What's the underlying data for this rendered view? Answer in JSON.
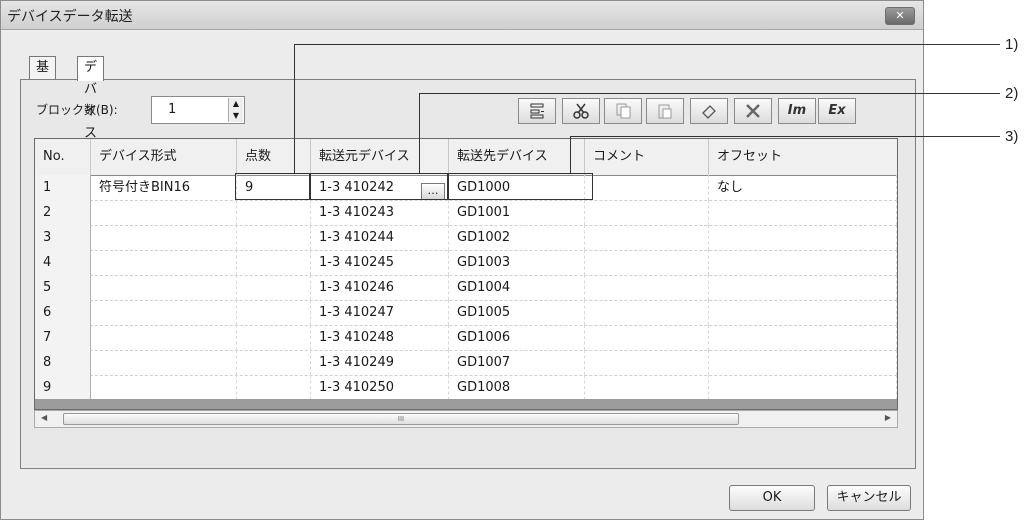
{
  "window": {
    "title": "デバイスデータ転送",
    "close_label": "✕"
  },
  "tabs": [
    {
      "label": "基本"
    },
    {
      "label": "デバイス"
    }
  ],
  "block": {
    "label": "ブロック数(B):",
    "value": "1"
  },
  "toolbar": {
    "icons": [
      "insert-row-icon",
      "cut-icon",
      "copy-icon",
      "paste-icon",
      "eraser-icon",
      "delete-icon",
      "import-icon",
      "export-icon"
    ],
    "im_label": "Im",
    "ex_label": "Ex"
  },
  "table": {
    "headers": [
      "No.",
      "デバイス形式",
      "点数",
      "転送元デバイス",
      "転送先デバイス",
      "コメント",
      "オフセット"
    ],
    "rows": [
      [
        "1",
        "符号付きBIN16",
        "9",
        "1-3 410242",
        "GD1000",
        "",
        "なし"
      ],
      [
        "2",
        "",
        "",
        "1-3 410243",
        "GD1001",
        "",
        ""
      ],
      [
        "3",
        "",
        "",
        "1-3 410244",
        "GD1002",
        "",
        ""
      ],
      [
        "4",
        "",
        "",
        "1-3 410245",
        "GD1003",
        "",
        ""
      ],
      [
        "5",
        "",
        "",
        "1-3 410246",
        "GD1004",
        "",
        ""
      ],
      [
        "6",
        "",
        "",
        "1-3 410247",
        "GD1005",
        "",
        ""
      ],
      [
        "7",
        "",
        "",
        "1-3 410248",
        "GD1006",
        "",
        ""
      ],
      [
        "8",
        "",
        "",
        "1-3 410249",
        "GD1007",
        "",
        ""
      ],
      [
        "9",
        "",
        "",
        "1-3 410250",
        "GD1008",
        "",
        ""
      ]
    ],
    "dots_label": "…"
  },
  "scrollbar": {
    "grip": "III",
    "left_arrow": "◀",
    "right_arrow": "▶"
  },
  "buttons": {
    "ok": "OK",
    "cancel": "キャンセル"
  },
  "callouts": [
    "1)",
    "2)",
    "3)"
  ]
}
